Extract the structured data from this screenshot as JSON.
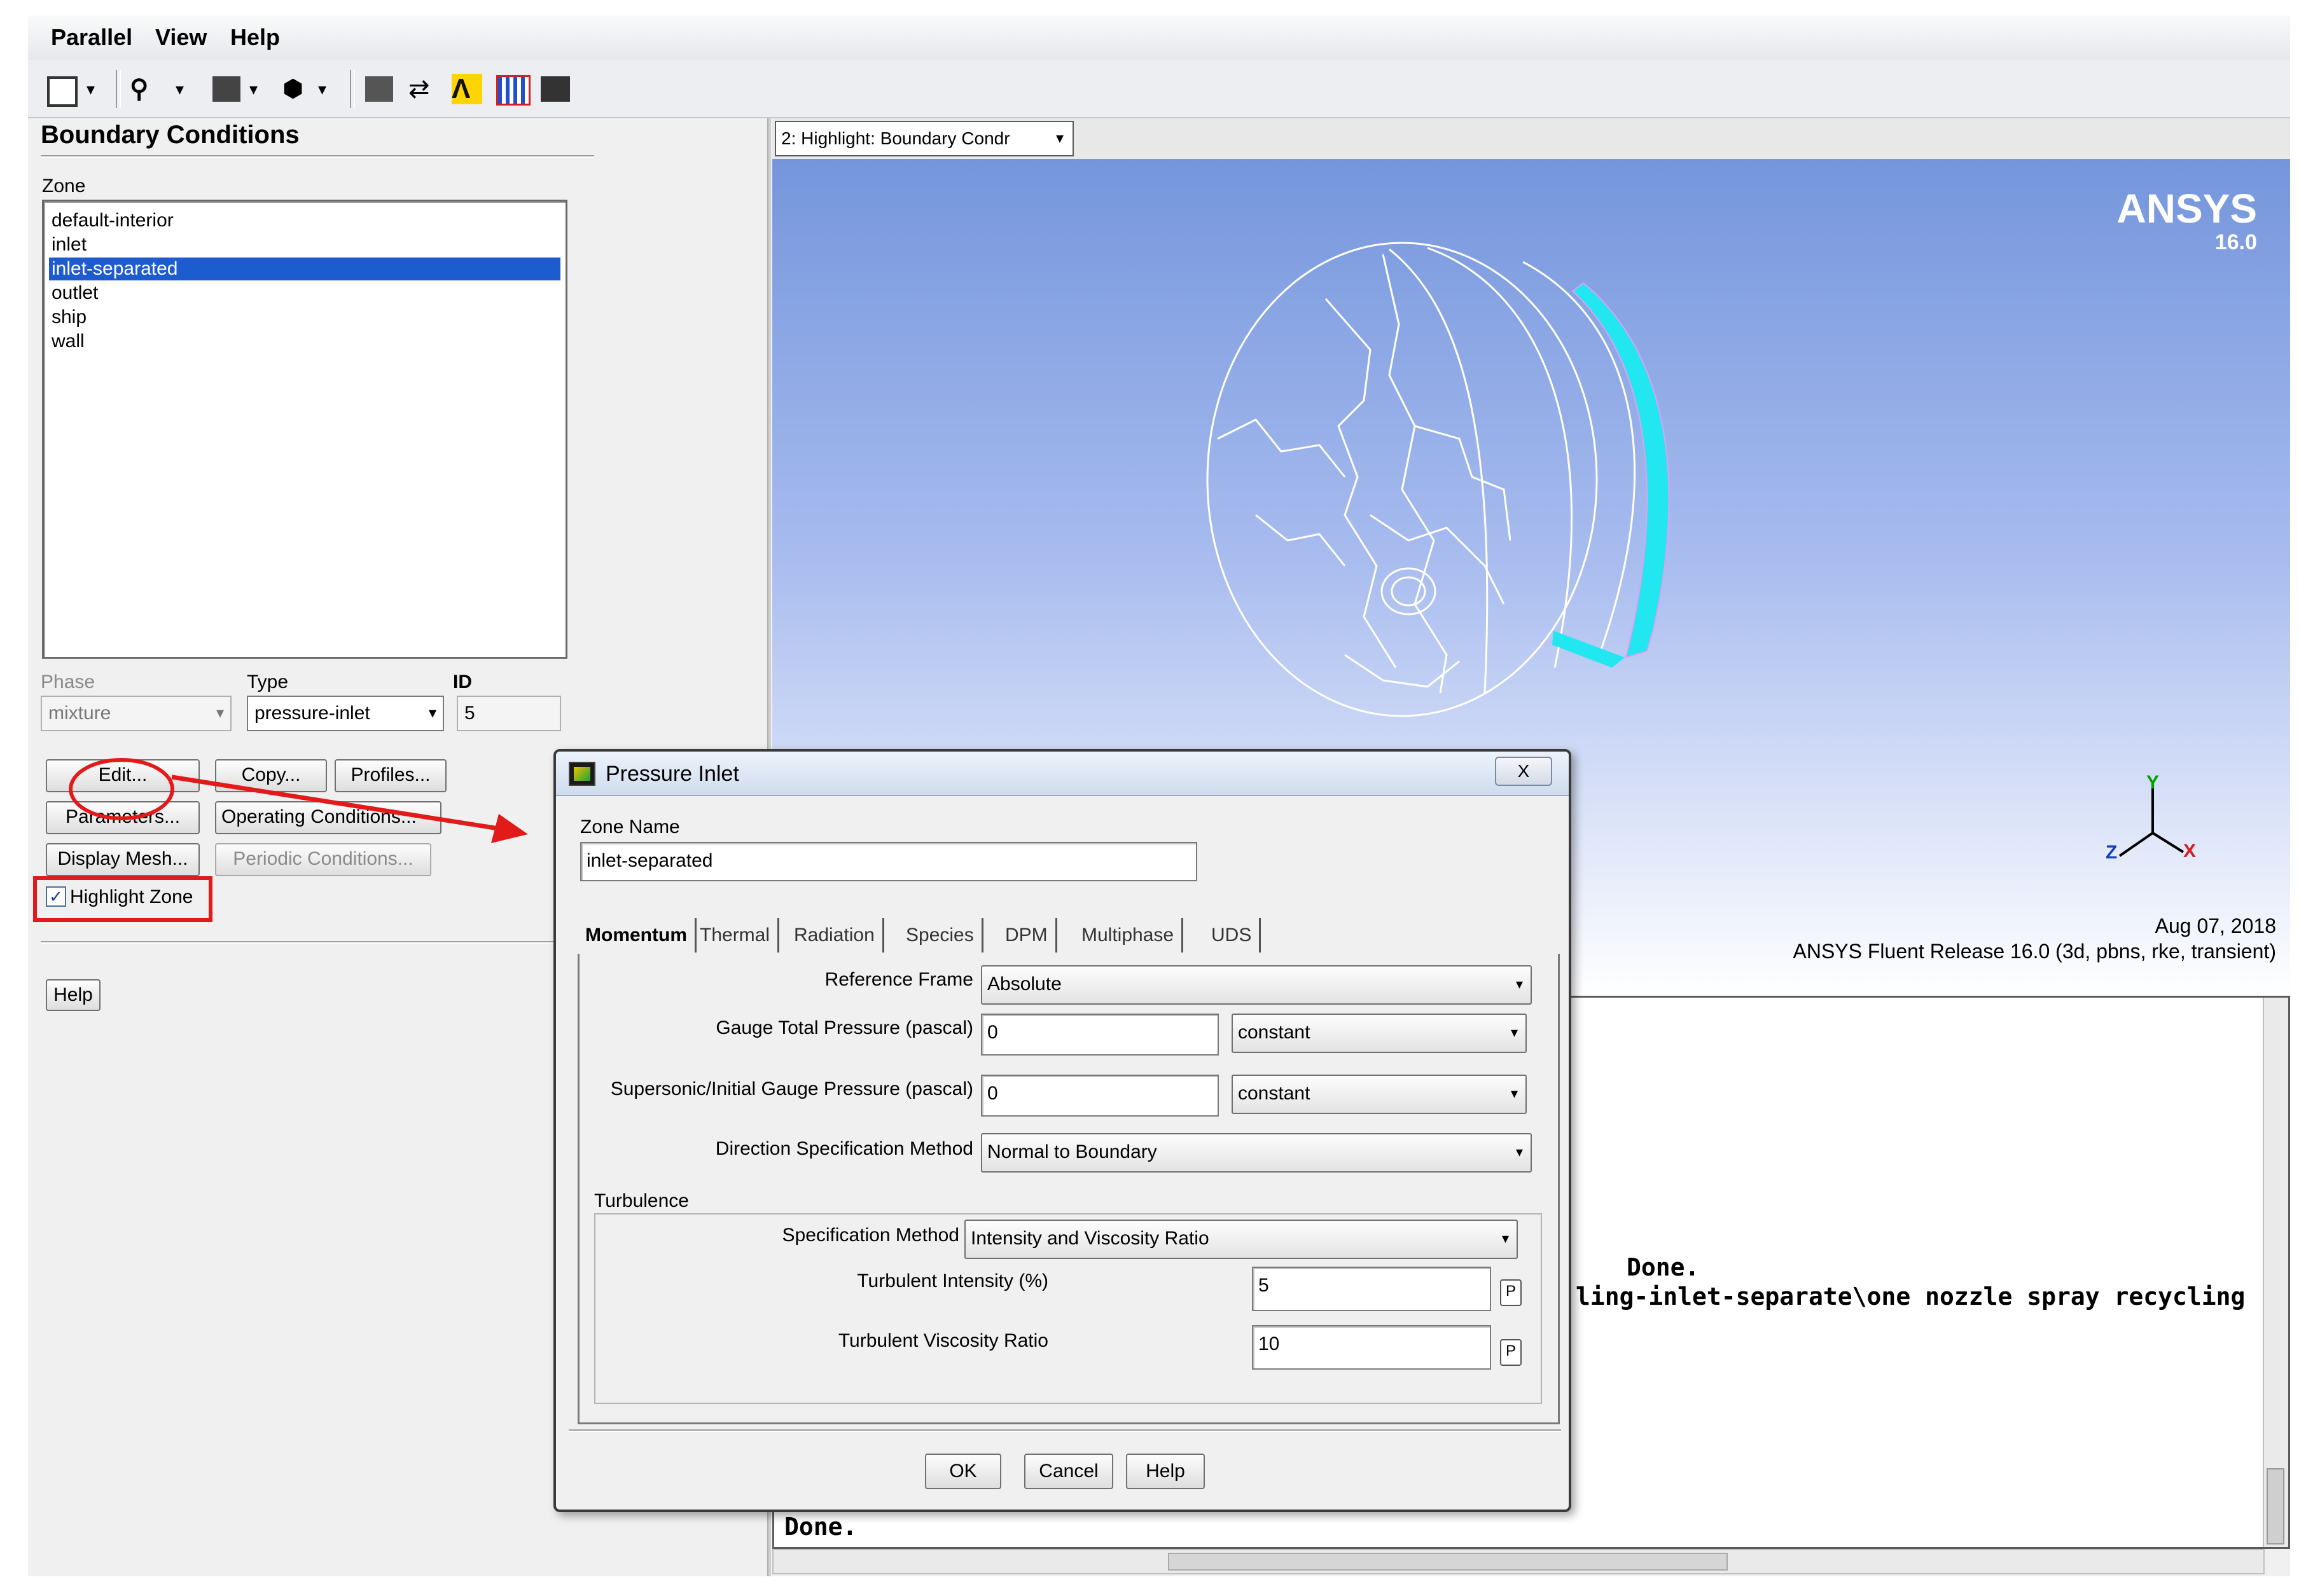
{
  "menu": [
    "Parallel",
    "View",
    "Help"
  ],
  "left_panel": {
    "title": "Boundary Conditions",
    "zone_label": "Zone",
    "zones": [
      "default-interior",
      "inlet",
      "inlet-separated",
      "outlet",
      "ship",
      "wall"
    ],
    "selected_zone": "inlet-separated",
    "phase_label": "Phase",
    "phase_value": "mixture",
    "type_label": "Type",
    "type_value": "pressure-inlet",
    "id_label": "ID",
    "id_value": "5",
    "buttons": {
      "edit": "Edit...",
      "copy": "Copy...",
      "profiles": "Profiles...",
      "parameters": "Parameters...",
      "operating_conditions": "Operating Conditions...",
      "display_mesh": "Display Mesh...",
      "periodic_conditions": "Periodic Conditions..."
    },
    "highlight_zone_label": "Highlight Zone",
    "highlight_zone_checked": true,
    "help_button": "Help"
  },
  "graphics": {
    "window_select": "2: Highlight: Boundary Condr",
    "logo": "ANSYS",
    "version": "16.0",
    "date": "Aug 07, 2018",
    "release": "ANSYS Fluent Release 16.0 (3d, pbns, rke, transient)",
    "axes": {
      "y": "Y",
      "z": "Z",
      "x": "X"
    },
    "highlight_color": "#22e6f0",
    "background_top": "#7596dc"
  },
  "console": {
    "lines": [
      "Done.",
      "ling-inlet-separate\\one nozzle spray recycling",
      "Done."
    ]
  },
  "dialog": {
    "title": "Pressure Inlet",
    "close_glyph": "X",
    "zone_name_label": "Zone Name",
    "zone_name_value": "inlet-separated",
    "tabs": [
      "Momentum",
      "Thermal",
      "Radiation",
      "Species",
      "DPM",
      "Multiphase",
      "UDS"
    ],
    "active_tab": "Momentum",
    "reference_frame_label": "Reference Frame",
    "reference_frame_value": "Absolute",
    "gauge_total_pressure_label": "Gauge Total Pressure (pascal)",
    "gauge_total_pressure_value": "0",
    "gauge_total_pressure_method": "constant",
    "supersonic_pressure_label": "Supersonic/Initial Gauge Pressure (pascal)",
    "supersonic_pressure_value": "0",
    "supersonic_pressure_method": "constant",
    "direction_method_label": "Direction Specification Method",
    "direction_method_value": "Normal to Boundary",
    "turbulence_label": "Turbulence",
    "spec_method_label": "Specification Method",
    "spec_method_value": "Intensity and Viscosity Ratio",
    "turb_intensity_label": "Turbulent Intensity (%)",
    "turb_intensity_value": "5",
    "turb_viscosity_label": "Turbulent Viscosity Ratio",
    "turb_viscosity_value": "10",
    "param_glyph": "P",
    "buttons": {
      "ok": "OK",
      "cancel": "Cancel",
      "help": "Help"
    }
  },
  "annotation_color": "#e21a1a"
}
